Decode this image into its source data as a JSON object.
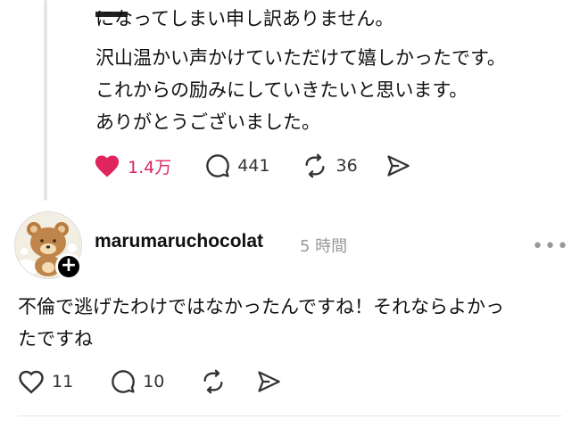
{
  "post": {
    "lines": [
      "になってしまい申し訳ありません。",
      "沢山温かい声かけていただけて嬉しかったです。",
      "これからの励みにしていきたいと思います。",
      "ありがとうございました。"
    ],
    "like_count": "1.4万",
    "comment_count": "441",
    "repost_count": "36"
  },
  "reply": {
    "username": "marumaruchocolat",
    "time": "5 時間",
    "more": "•••",
    "lines": [
      "不倫で逃げたわけではなかったんですね！それならよかっ",
      "たですね"
    ],
    "like_count": "11",
    "comment_count": "10"
  },
  "colors": {
    "like_active": "#e0245e",
    "icon": "#333333"
  },
  "icons": [
    "heart-icon",
    "comment-icon",
    "repost-icon",
    "share-icon",
    "more-icon",
    "follow-plus-icon"
  ]
}
